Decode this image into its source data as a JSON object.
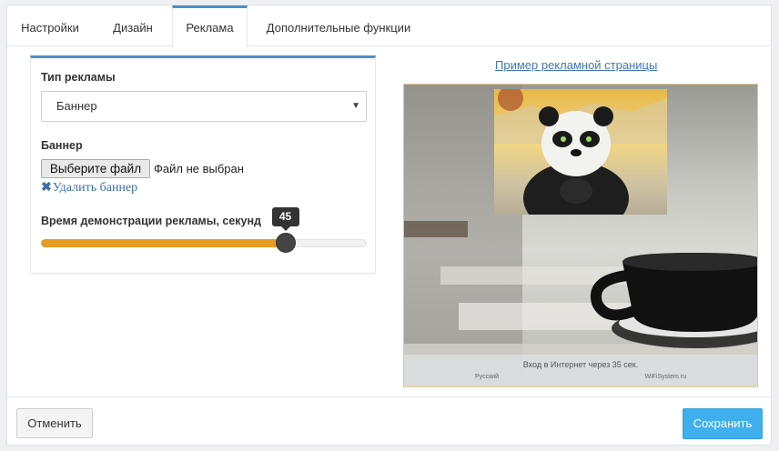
{
  "tabs": [
    {
      "label": "Настройки",
      "active": false
    },
    {
      "label": "Дизайн",
      "active": false
    },
    {
      "label": "Реклама",
      "active": true
    },
    {
      "label": "Дополнительные функции",
      "active": false
    }
  ],
  "ad_settings": {
    "type_label": "Тип рекламы",
    "type_selected": "Баннер",
    "banner_label": "Баннер",
    "file_button": "Выберите файл",
    "file_status": "Файл не выбран",
    "remove_banner": "Удалить баннер",
    "duration_label": "Время демонстрации рекламы, секунд",
    "duration_value": "45",
    "duration_fraction": 0.75,
    "accent_color": "#e79b27"
  },
  "preview": {
    "link": "Пример рекламной страницы",
    "bar_text": "Вход в Интернет через 35 сек.",
    "lang": "Русский",
    "brand": "WiFiSystem.ru"
  },
  "footer": {
    "cancel": "Отменить",
    "save": "Сохранить",
    "save_color": "#3fb0ed"
  },
  "icons": {
    "remove": "close-icon",
    "select": "caret-down-icon"
  }
}
